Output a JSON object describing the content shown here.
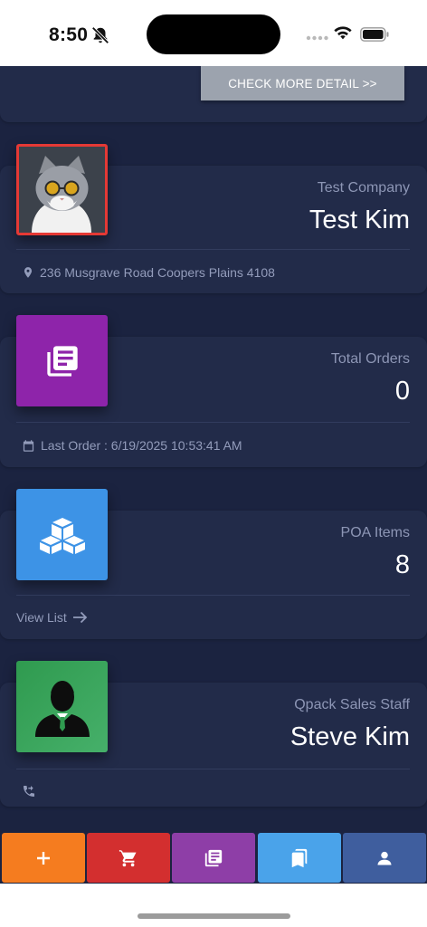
{
  "status_bar": {
    "time": "8:50",
    "icons": [
      "bell-off-icon",
      "signal-icon",
      "wifi-icon",
      "battery-icon"
    ]
  },
  "detail_button": {
    "label": "CHECK MORE DETAIL >>"
  },
  "customer_card": {
    "company": "Test Company",
    "name": "Test Kim",
    "address": "236 Musgrave Road Coopers Plains 4108",
    "avatar": "cat-with-sunglasses-photo",
    "avatar_border_color": "#e53935"
  },
  "orders_card": {
    "label": "Total Orders",
    "value": "0",
    "last_order": "Last Order : 6/19/2025 10:53:41 AM",
    "icon": "orders-list-icon",
    "color": "#8e24aa"
  },
  "poa_card": {
    "label": "POA Items",
    "value": "8",
    "link": "View List",
    "icon": "boxes-icon",
    "color": "#3d93e6"
  },
  "staff_card": {
    "label": "Qpack Sales Staff",
    "name": "Steve Kim",
    "icon": "staff-avatar-icon",
    "color": "#3da35d"
  },
  "bottom_nav": [
    {
      "icon": "plus-icon",
      "color": "#f57c1f"
    },
    {
      "icon": "cart-icon",
      "color": "#d32f2f"
    },
    {
      "icon": "orders-icon",
      "color": "#8e3ea7"
    },
    {
      "icon": "bookmarks-icon",
      "color": "#4aa3ea"
    },
    {
      "icon": "person-icon",
      "color": "#3f5e9e"
    }
  ]
}
